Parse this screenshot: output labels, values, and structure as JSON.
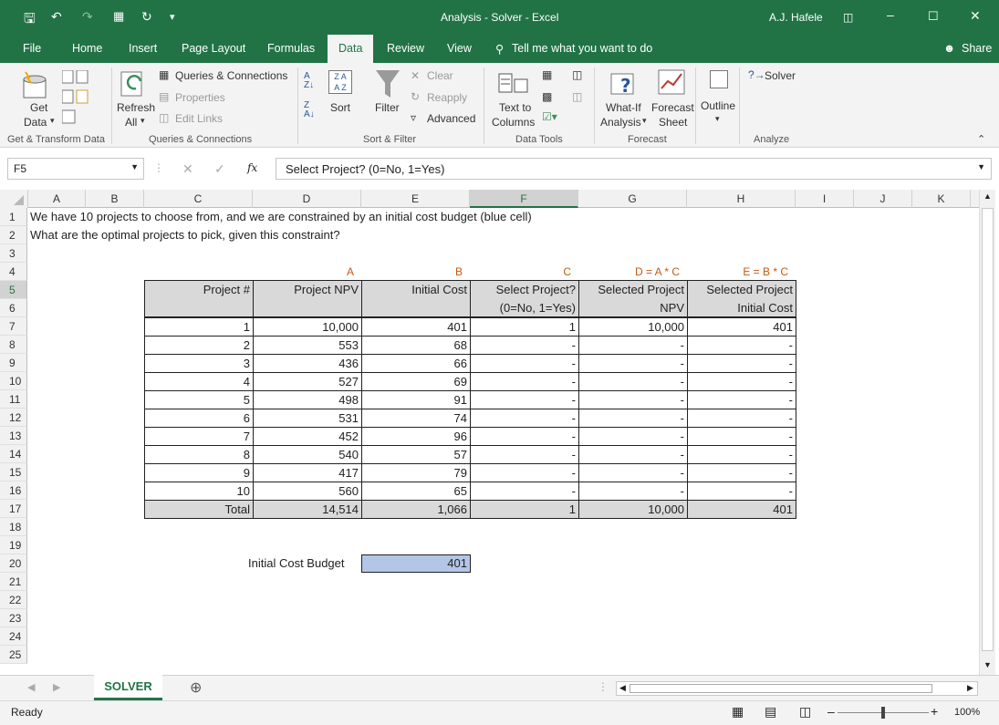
{
  "window": {
    "title": "Analysis - Solver  -  Excel",
    "user": "A.J. Hafele"
  },
  "tabs": [
    "File",
    "Home",
    "Insert",
    "Page Layout",
    "Formulas",
    "Data",
    "Review",
    "View"
  ],
  "tell_me": "Tell me what you want to do",
  "share": "Share",
  "ribbon": {
    "get_data_1": "Get",
    "get_data_2": "Data",
    "queries_connections": "Queries & Connections",
    "properties": "Properties",
    "edit_links": "Edit Links",
    "refresh_1": "Refresh",
    "refresh_2": "All",
    "sort": "Sort",
    "filter": "Filter",
    "clear": "Clear",
    "reapply": "Reapply",
    "advanced": "Advanced",
    "text_to_columns_1": "Text to",
    "text_to_columns_2": "Columns",
    "what_if_1": "What-If",
    "what_if_2": "Analysis",
    "forecast_1": "Forecast",
    "forecast_2": "Sheet",
    "outline": "Outline",
    "solver": "Solver",
    "groups": [
      "Get & Transform Data",
      "Queries & Connections",
      "Sort & Filter",
      "Data Tools",
      "Forecast",
      "Analyze"
    ]
  },
  "formula_bar": {
    "name_box": "F5",
    "fx": "fx",
    "formula": "Select Project? (0=No, 1=Yes)"
  },
  "columns": [
    "A",
    "B",
    "C",
    "D",
    "E",
    "F",
    "G",
    "H",
    "I",
    "J",
    "K"
  ],
  "rows": [
    "1",
    "2",
    "3",
    "4",
    "5",
    "6",
    "7",
    "8",
    "9",
    "10",
    "11",
    "12",
    "13",
    "14",
    "15",
    "16",
    "17",
    "18",
    "19",
    "20",
    "21",
    "22",
    "23",
    "24",
    "25"
  ],
  "sheet": {
    "line1": "We have 10 projects to choose from, and we are constrained by an initial cost budget (blue cell)",
    "line2": "What are the optimal projects to pick, given this constraint?",
    "col_letters": [
      "A",
      "B",
      "C",
      "D = A * C",
      "E = B * C"
    ],
    "headers": {
      "project": "Project #",
      "npv": "Project NPV",
      "cost": "Initial Cost",
      "select_1": "Select Project?",
      "select_2": "(0=No, 1=Yes)",
      "selnpv_1": "Selected Project",
      "selnpv_2": "NPV",
      "selcost_1": "Selected Project",
      "selcost_2": "Initial Cost"
    },
    "data": [
      [
        "1",
        "10,000",
        "401",
        "1",
        "10,000",
        "401"
      ],
      [
        "2",
        "553",
        "68",
        "-",
        "-",
        "-"
      ],
      [
        "3",
        "436",
        "66",
        "-",
        "-",
        "-"
      ],
      [
        "4",
        "527",
        "69",
        "-",
        "-",
        "-"
      ],
      [
        "5",
        "498",
        "91",
        "-",
        "-",
        "-"
      ],
      [
        "6",
        "531",
        "74",
        "-",
        "-",
        "-"
      ],
      [
        "7",
        "452",
        "96",
        "-",
        "-",
        "-"
      ],
      [
        "8",
        "540",
        "57",
        "-",
        "-",
        "-"
      ],
      [
        "9",
        "417",
        "79",
        "-",
        "-",
        "-"
      ],
      [
        "10",
        "560",
        "65",
        "-",
        "-",
        "-"
      ]
    ],
    "total": [
      "Total",
      "14,514",
      "1,066",
      "1",
      "10,000",
      "401"
    ],
    "budget_label": "Initial Cost Budget",
    "budget_value": "401",
    "budget_color": "#b4c6e7"
  },
  "sheet_tab": "SOLVER",
  "status": {
    "ready": "Ready",
    "zoom": "100%"
  },
  "colors": {
    "excel_green": "#217346",
    "header_fill": "#d9d9d9",
    "orange_label": "#c65911"
  }
}
